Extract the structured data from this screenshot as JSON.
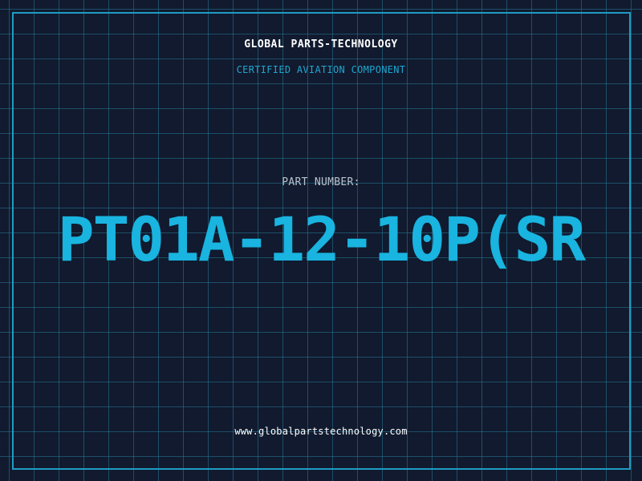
{
  "header": {
    "company": "GLOBAL PARTS-TECHNOLOGY",
    "subtitle": "CERTIFIED AVIATION COMPONENT"
  },
  "part": {
    "label": "PART NUMBER:",
    "number": "PT01A-12-10P(SR"
  },
  "footer": {
    "website": "www.globalpartstechnology.com"
  },
  "colors": {
    "background": "#111a2e",
    "grid": "#26788f",
    "frame": "#1f9cc4",
    "accent": "#19b4e0",
    "label": "#b9c3cf",
    "text": "#ffffff"
  }
}
